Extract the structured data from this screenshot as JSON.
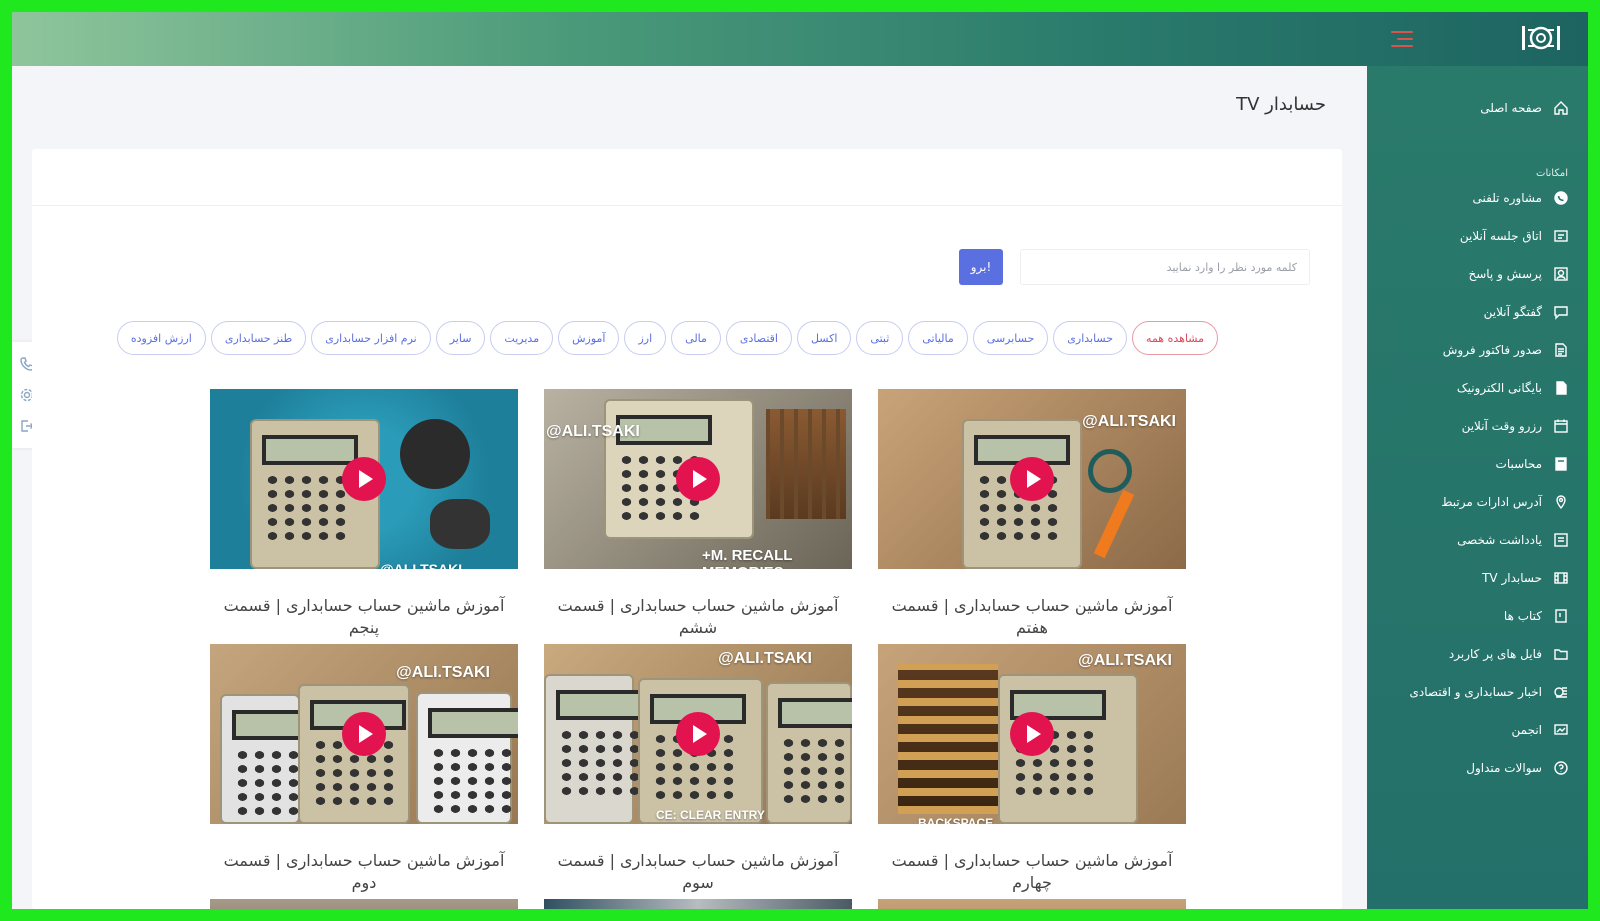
{
  "header": {
    "logo": "logo-icon",
    "menu": "hamburger-icon"
  },
  "sidebar": {
    "section_label": "امکانات",
    "items": [
      {
        "label": "صفحه اصلی",
        "icon": "home-icon"
      },
      {
        "label": "مشاوره تلفنی",
        "icon": "whatsapp-icon"
      },
      {
        "label": "اتاق جلسه آنلاین",
        "icon": "meeting-icon"
      },
      {
        "label": "پرسش و پاسخ",
        "icon": "question-answer-icon"
      },
      {
        "label": "گفتگو آنلاین",
        "icon": "chat-icon"
      },
      {
        "label": "صدور فاکتور فروش",
        "icon": "invoice-icon"
      },
      {
        "label": "بایگانی الکترونیک",
        "icon": "file-icon"
      },
      {
        "label": "رزرو وقت آنلاین",
        "icon": "calendar-icon"
      },
      {
        "label": "محاسبات",
        "icon": "calculator-icon"
      },
      {
        "label": "آدرس ادارات مرتبط",
        "icon": "map-pin-icon"
      },
      {
        "label": "یادداشت شخصی",
        "icon": "notes-icon"
      },
      {
        "label": "حسابدار TV",
        "icon": "film-icon"
      },
      {
        "label": "کتاب ها",
        "icon": "book-icon"
      },
      {
        "label": "فایل های پر کاربرد",
        "icon": "folder-icon"
      },
      {
        "label": "اخبار حسابداری و اقتصادی",
        "icon": "news-icon"
      },
      {
        "label": "انجمن",
        "icon": "forum-icon"
      },
      {
        "label": "سوالات متداول",
        "icon": "help-icon"
      }
    ]
  },
  "main": {
    "title": "حسابدار TV",
    "search": {
      "placeholder": "کلمه مورد نظر را وارد نمایید",
      "value": ""
    },
    "go_label": "برو!",
    "filters": [
      "مشاهده همه",
      "حسابداری",
      "حسابرسی",
      "مالیاتی",
      "ثبتی",
      "اکسل",
      "اقتصادی",
      "مالی",
      "ارز",
      "آموزش",
      "مدیریت",
      "سایر",
      "نرم افزار حسابداری",
      "طنز حسابداری",
      "ارزش افزوده"
    ],
    "active_filter": 0,
    "videos": [
      {
        "title": "آموزش ماشین حساب حسابداری | قسمت هفتم",
        "watermark": "@ALI.TSAKI",
        "caption": ""
      },
      {
        "title": "آموزش ماشین حساب حسابداری | قسمت ششم",
        "watermark": "@ALI.TSAKI",
        "caption": "+M. RECALL MEMORIES"
      },
      {
        "title": "آموزش ماشین حساب حسابداری | قسمت پنجم",
        "watermark": "",
        "caption": "@ALI.TSAKI"
      },
      {
        "title": "آموزش ماشین حساب حسابداری | قسمت چهارم",
        "watermark": "@ALI.TSAKI",
        "caption": "BACKSPACE"
      },
      {
        "title": "آموزش ماشین حساب حسابداری | قسمت سوم",
        "watermark": "@ALI.TSAKI",
        "caption": "CE: CLEAR ENTRY"
      },
      {
        "title": "آموزش ماشین حساب حسابداری | قسمت دوم",
        "watermark": "@ALI.TSAKI",
        "caption": ""
      }
    ]
  },
  "colors": {
    "accent": "#5a6fe0",
    "sidebar": "#23706a",
    "play": "#e2134f",
    "active_chip": "#d9475a"
  }
}
